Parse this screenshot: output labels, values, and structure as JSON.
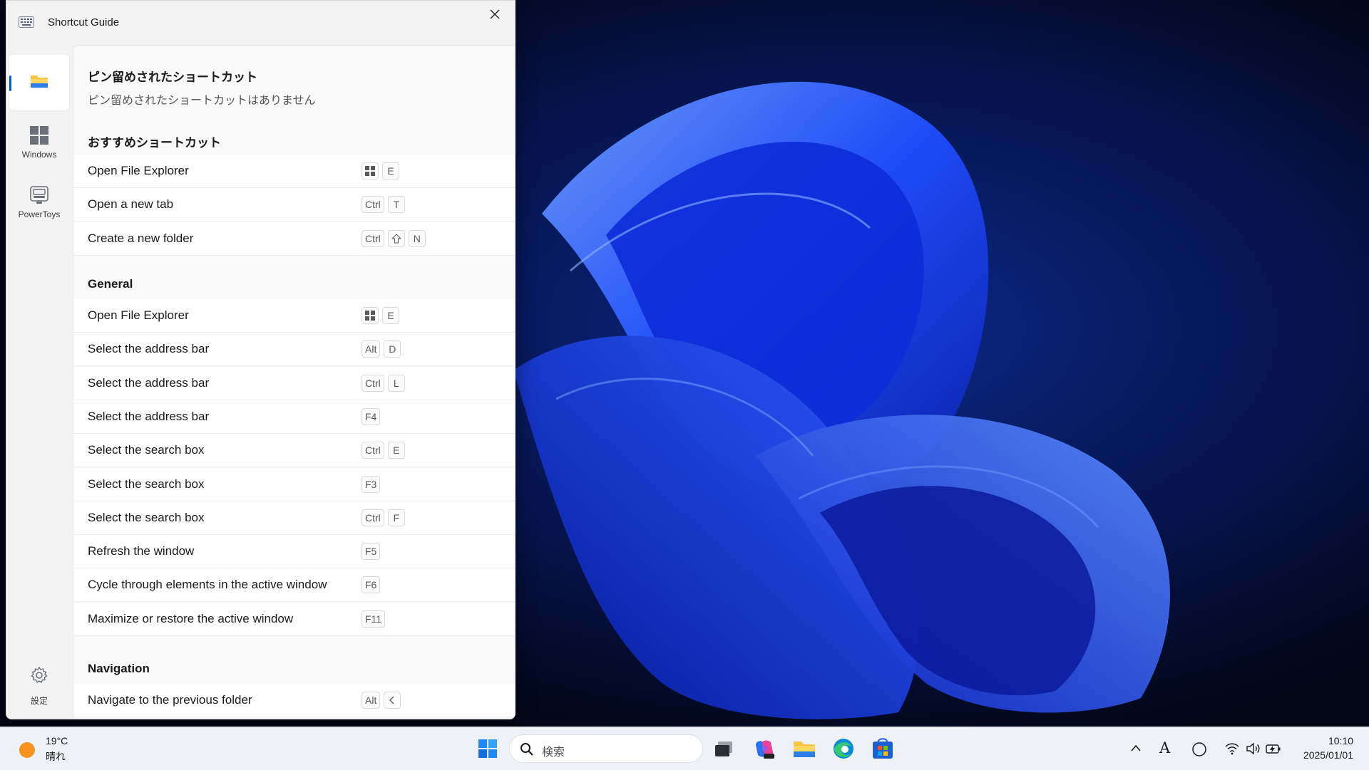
{
  "window": {
    "title": "Shortcut Guide",
    "title_icon": "keyboard-icon",
    "close_icon": "close-icon"
  },
  "nav": {
    "items": [
      {
        "label": "",
        "icon": "file-explorer-icon",
        "selected": true
      },
      {
        "label": "Windows",
        "icon": "windows-logo-icon",
        "selected": false
      },
      {
        "label": "PowerToys",
        "icon": "powertoys-icon",
        "selected": false
      }
    ],
    "settings_label": "設定"
  },
  "content": {
    "pinned_title": "ピン留めされたショートカット",
    "pinned_empty": "ピン留めされたショートカットはありません",
    "recommended_title": "おすすめショートカット",
    "recommended": [
      {
        "label": "Open File Explorer",
        "keys": [
          "win",
          "E"
        ]
      },
      {
        "label": "Open a new tab",
        "keys": [
          "Ctrl",
          "T"
        ]
      },
      {
        "label": "Create a new folder",
        "keys": [
          "Ctrl",
          "shift",
          "N"
        ]
      }
    ],
    "general_title": "General",
    "general": [
      {
        "label": "Open File Explorer",
        "keys": [
          "win",
          "E"
        ]
      },
      {
        "label": "Select the address bar",
        "keys": [
          "Alt",
          "D"
        ]
      },
      {
        "label": "Select the address bar",
        "keys": [
          "Ctrl",
          "L"
        ]
      },
      {
        "label": "Select the address bar",
        "keys": [
          "F4"
        ]
      },
      {
        "label": "Select the search box",
        "keys": [
          "Ctrl",
          "E"
        ]
      },
      {
        "label": "Select the search box",
        "keys": [
          "F3"
        ]
      },
      {
        "label": "Select the search box",
        "keys": [
          "Ctrl",
          "F"
        ]
      },
      {
        "label": "Refresh the window",
        "keys": [
          "F5"
        ]
      },
      {
        "label": "Cycle through elements in the active window",
        "keys": [
          "F6"
        ]
      },
      {
        "label": "Maximize or restore the active window",
        "keys": [
          "F11"
        ]
      }
    ],
    "navigation_title": "Navigation",
    "navigation": [
      {
        "label": "Navigate to the previous folder",
        "keys": [
          "Alt",
          "left-arrow"
        ]
      }
    ]
  },
  "taskbar": {
    "weather": {
      "temp": "19°C",
      "condition": "晴れ",
      "icon": "sun-icon"
    },
    "search_placeholder": "検索",
    "apps": [
      "windows-start-icon",
      "task-view-icon",
      "m365-copilot-icon",
      "file-explorer-icon",
      "edge-icon",
      "microsoft-store-icon"
    ],
    "tray": {
      "ime": "A",
      "icons": [
        "chevron-up-icon",
        "ime-mode-icon",
        "focus-icon",
        "wifi-icon",
        "volume-icon",
        "battery-icon"
      ],
      "time": "10:10",
      "date": "2025/01/01"
    }
  },
  "colors": {
    "accent": "#005fb8",
    "wallpaper_blue": "#1f4dff"
  }
}
